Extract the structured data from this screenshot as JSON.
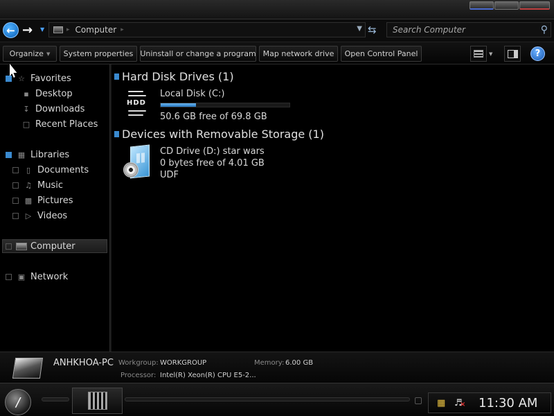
{
  "address": {
    "location": "Computer",
    "search_placeholder": "Search Computer"
  },
  "commands": {
    "organize": "Organize",
    "system_properties": "System properties",
    "uninstall": "Uninstall or change a program",
    "map_drive": "Map network drive",
    "control_panel": "Open Control Panel"
  },
  "nav": {
    "favorites": "Favorites",
    "desktop": "Desktop",
    "downloads": "Downloads",
    "recent_places": "Recent Places",
    "libraries": "Libraries",
    "documents": "Documents",
    "music": "Music",
    "pictures": "Pictures",
    "videos": "Videos",
    "computer": "Computer",
    "network": "Network"
  },
  "groups": {
    "hdd_header": "Hard Disk Drives (1)",
    "removable_header": "Devices with Removable Storage (1)"
  },
  "drives": {
    "local": {
      "icon_label": "HDD",
      "name": "Local Disk (C:)",
      "free": "50.6 GB free of 69.8 GB",
      "used_fraction": 0.275
    },
    "cd": {
      "name": "CD Drive (D:) star wars",
      "free": "0 bytes free of 4.01 GB",
      "fs": "UDF"
    }
  },
  "details": {
    "pc_name": "ANHKHOA-PC",
    "workgroup_label": "Workgroup:",
    "workgroup": "WORKGROUP",
    "memory_label": "Memory:",
    "memory": "6.00 GB",
    "processor_label": "Processor:",
    "processor": "Intel(R) Xeon(R) CPU E5-2..."
  },
  "taskbar": {
    "clock": "11:30 AM"
  },
  "icons": {
    "back": "arrow-left-icon",
    "forward": "arrow-right-icon",
    "search": "search-icon",
    "help": "help-icon",
    "hdd": "hard-disk-icon",
    "cd": "cd-drive-icon"
  },
  "colors": {
    "accent": "#3a8ad0",
    "usage_fill": "#2878c0",
    "background": "#000000"
  }
}
